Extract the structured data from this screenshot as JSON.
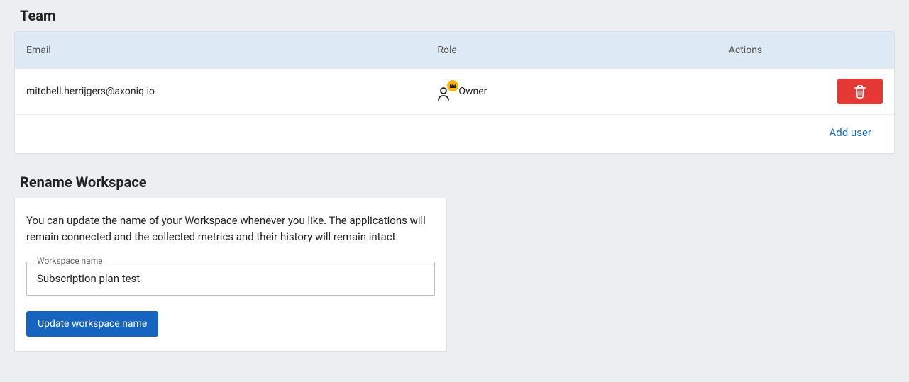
{
  "team": {
    "title": "Team",
    "headers": {
      "email": "Email",
      "role": "Role",
      "actions": "Actions"
    },
    "rows": [
      {
        "email": "mitchell.herrijgers@axoniq.io",
        "role": "Owner"
      }
    ],
    "add_user_label": "Add user"
  },
  "rename": {
    "title": "Rename Workspace",
    "description": "You can update the name of your Workspace whenever you like. The applications will remain connected and the collected metrics and their history will remain intact.",
    "input_label": "Workspace name",
    "input_value": "Subscription plan test",
    "button_label": "Update workspace name"
  }
}
